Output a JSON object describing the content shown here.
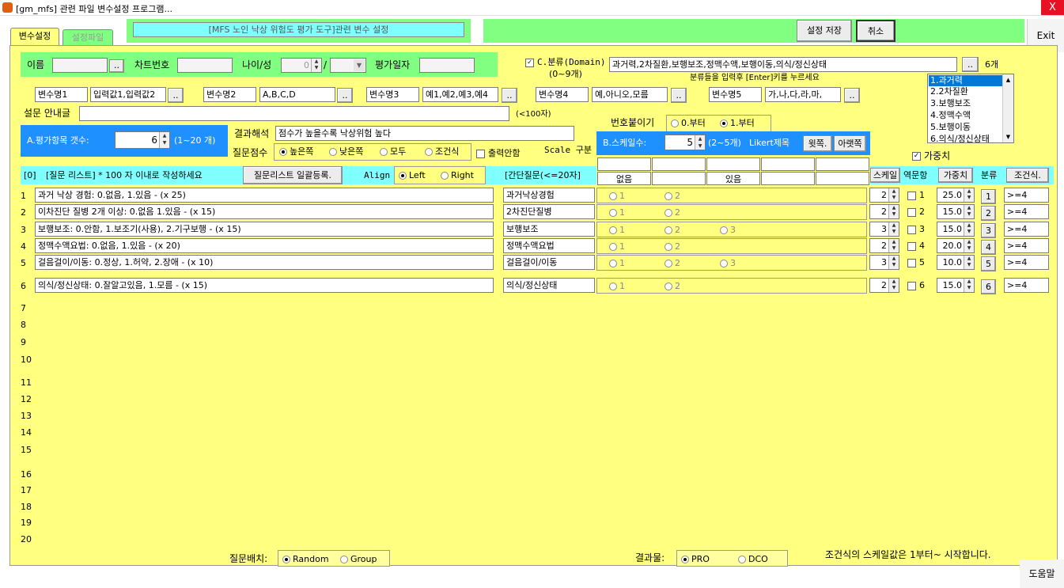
{
  "window": {
    "title": "[gm_mfs] 관련 파일 변수설정 프로그램...",
    "close": "X"
  },
  "tabs": [
    {
      "label": "변수설정"
    },
    {
      "label": "설정파일"
    }
  ],
  "header_title": "[MFS 노인 낙상 위험도 평가 도구]관련 변수 설정",
  "buttons": {
    "save": "설정 저장",
    "cancel": "취소",
    "exit": "Exit",
    "help": "도움말",
    "dots": "..",
    "bulk": "질문리스트 일괄등록.",
    "upper": "윗쪽.",
    "lower": "아랫쪽",
    "weight": "가중치",
    "condition": "조건식."
  },
  "patient": {
    "name_label": "이름",
    "chart_label": "차트번호",
    "age_label": "나이/성",
    "age_value": "0",
    "slash": "/",
    "date_label": "평가일자"
  },
  "domain": {
    "checkbox_label": "C.분류(Domain)",
    "range": "(0~9개)",
    "value": "과거력,2차질환,보행보조,정맥수액,보행이동,의식/정신상태",
    "count": "6개",
    "hint": "분류들을 입력후 [Enter]키를 누르세요",
    "list": [
      "1.과거력",
      "2.2차질환",
      "3.보행보조",
      "4.정맥수액",
      "5.보행이동",
      "6.의식/정신상태"
    ]
  },
  "variables": [
    {
      "name": "변수명1",
      "value": "입력값1,입력값2"
    },
    {
      "name": "변수명2",
      "value": "A,B,C,D"
    },
    {
      "name": "변수명3",
      "value": "예1,예2,예3,예4"
    },
    {
      "name": "변수명4",
      "value": "예,아니오,모름"
    },
    {
      "name": "변수명5",
      "value": "가,나,다,라,마,"
    }
  ],
  "survey": {
    "guide_label": "설문 안내글",
    "guide_limit": "(<100자)"
  },
  "eval": {
    "label": "A.평가항목 갯수:",
    "value": "6",
    "range": "(1~20 개)"
  },
  "result": {
    "label": "결과해석",
    "value": "점수가 높을수록 낙상위험 높다",
    "score_label": "질문점수",
    "score_options": [
      "높은쪽",
      "낮은쪽",
      "모두",
      "조건식"
    ],
    "print_label": "출력안함",
    "scale_div": "Scale 구분"
  },
  "numbering": {
    "label": "번호붙이기",
    "options": [
      "0.부터",
      "1.부터"
    ]
  },
  "scale": {
    "label": "B.스케일수:",
    "value": "5",
    "range": "(2~5개)",
    "likert": "Likert제목",
    "headers": [
      "없음",
      "있음"
    ]
  },
  "weight_check": "가중치",
  "list_header": {
    "col0": "[0]",
    "title": "[질문 리스트] * 100 자 이내로 작성하세요",
    "align_label": "Align",
    "align_options": [
      "Left",
      "Right"
    ],
    "short": "[간단질문(<=20자]",
    "scale": "스케일",
    "reverse": "역문항",
    "category": "분류"
  },
  "questions": [
    {
      "num": "1",
      "text": "과거 낙상 경험:             0.없음, 1.있음 - (x 25)",
      "short": "과거낙상경험",
      "opts": [
        "1",
        "2"
      ],
      "scale": "2",
      "rev": "1",
      "weight": "25.0",
      "cat": "1",
      "cond": ">=4"
    },
    {
      "num": "2",
      "text": "이차진단 질병 2개 이상: 0.없음  1.있음 - (x 15)",
      "short": "2차진단질병",
      "opts": [
        "1",
        "2"
      ],
      "scale": "2",
      "rev": "2",
      "weight": "15.0",
      "cat": "2",
      "cond": ">=4"
    },
    {
      "num": "3",
      "text": "보행보조:                    0.안함, 1.보조기(사용), 2.기구보행 - (x 15)",
      "short": "보행보조",
      "opts": [
        "1",
        "2",
        "3"
      ],
      "scale": "3",
      "rev": "3",
      "weight": "15.0",
      "cat": "3",
      "cond": ">=4"
    },
    {
      "num": "4",
      "text": "정맥수액요법:               0.없음, 1.있음 - (x 20)",
      "short": "정맥수액요법",
      "opts": [
        "1",
        "2"
      ],
      "scale": "2",
      "rev": "4",
      "weight": "20.0",
      "cat": "4",
      "cond": ">=4"
    },
    {
      "num": "5",
      "text": "걸음걸이/이동:              0.정상, 1.허약, 2.장애 - (x 10)",
      "short": "걸음걸이/이동",
      "opts": [
        "1",
        "2",
        "3"
      ],
      "scale": "3",
      "rev": "5",
      "weight": "10.0",
      "cat": "5",
      "cond": ">=4"
    },
    {
      "num": "6",
      "text": "의식/정신상태:              0.잘알고있음, 1.모름 - (x 15)",
      "short": "의식/정신상태",
      "opts": [
        "1",
        "2"
      ],
      "scale": "2",
      "rev": "6",
      "weight": "15.0",
      "cat": "6",
      "cond": ">=4"
    }
  ],
  "empty_rows": [
    "7",
    "8",
    "9",
    "10",
    "11",
    "12",
    "13",
    "14",
    "15",
    "16",
    "17",
    "18",
    "19",
    "20"
  ],
  "footer": {
    "arrange_label": "질문배치:",
    "arrange_options": [
      "Random",
      "Group"
    ],
    "result_label": "결과물:",
    "result_options": [
      "PRO",
      "DCO"
    ],
    "note": "조건식의 스케일값은 1부터~ 시작합니다."
  }
}
